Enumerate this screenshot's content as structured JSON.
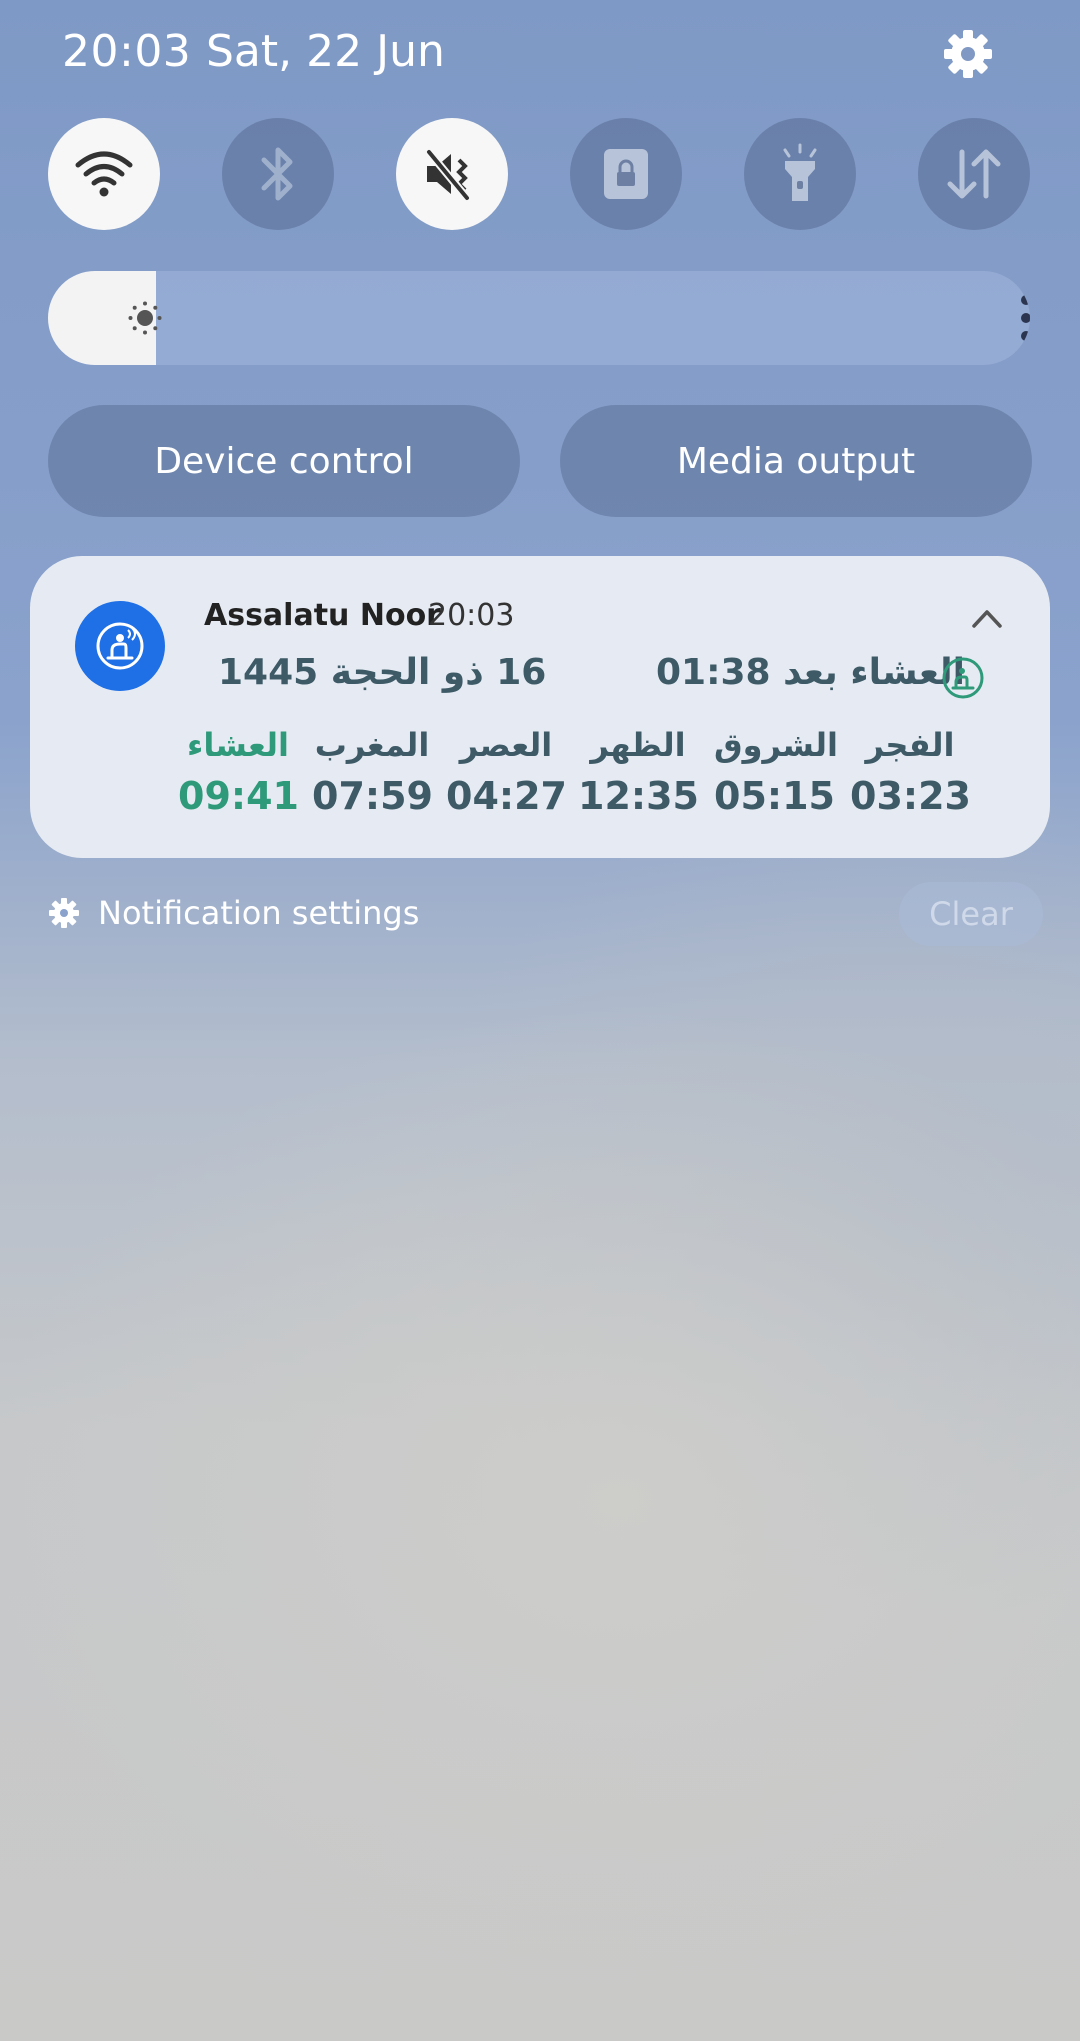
{
  "status_bar": {
    "time": "20:03",
    "date": "Sat, 22 Jun"
  },
  "quick_settings": {
    "tiles": [
      {
        "name": "wifi",
        "icon": "wifi-icon",
        "state": "on"
      },
      {
        "name": "bluetooth",
        "icon": "bluetooth-icon",
        "state": "off"
      },
      {
        "name": "mute",
        "icon": "sound-mute-icon",
        "state": "on"
      },
      {
        "name": "screen-lock",
        "icon": "lock-icon",
        "state": "off"
      },
      {
        "name": "flashlight",
        "icon": "flashlight-icon",
        "state": "off"
      },
      {
        "name": "mobile-data",
        "icon": "data-transfer-icon",
        "state": "off"
      }
    ],
    "brightness_level": 0.11,
    "device_control_label": "Device control",
    "media_output_label": "Media output"
  },
  "notification": {
    "app_name": "Assalatu Noor",
    "time": "20:03",
    "hijri_date": "16 ذو الحجة 1445",
    "next_prayer": "العشاء بعد 01:38",
    "prayers": [
      {
        "name": "الفجر",
        "time": "03:23",
        "active": false
      },
      {
        "name": "الشروق",
        "time": "05:15",
        "active": false
      },
      {
        "name": "الظهر",
        "time": "12:35",
        "active": false
      },
      {
        "name": "العصر",
        "time": "04:27",
        "active": false
      },
      {
        "name": "المغرب",
        "time": "07:59",
        "active": false
      },
      {
        "name": "العشاء",
        "time": "09:41",
        "active": true
      }
    ],
    "colors": {
      "primary_text": "#3d5a66",
      "active": "#2f9a7a",
      "app_icon_bg": "#1f6fe6"
    }
  },
  "footer": {
    "notification_settings_label": "Notification settings",
    "clear_label": "Clear"
  }
}
